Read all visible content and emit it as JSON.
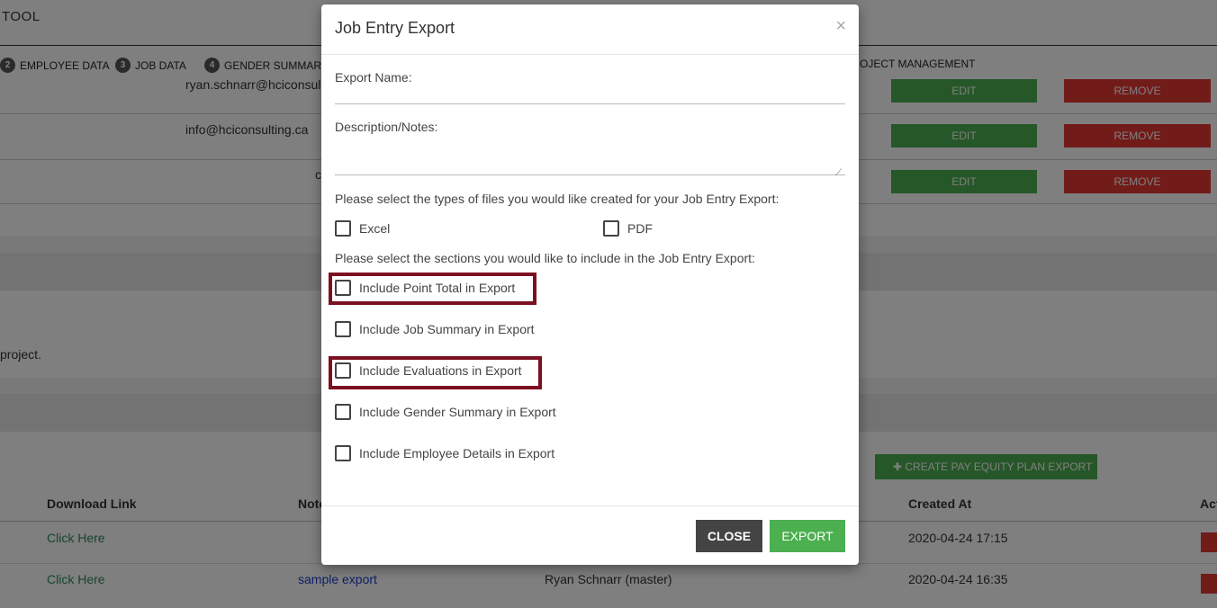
{
  "app": {
    "title": "TOOL"
  },
  "nav": {
    "items": [
      {
        "num": "2",
        "label": "EMPLOYEE DATA"
      },
      {
        "num": "3",
        "label": "JOB DATA"
      },
      {
        "num": "4",
        "label": "GENDER SUMMARY"
      }
    ],
    "project_management": "OJECT MANAGEMENT"
  },
  "users": {
    "rows": [
      {
        "email": "ryan.schnarr@hciconsul",
        "edit": "EDIT",
        "remove": "REMOVE"
      },
      {
        "email": "info@hciconsulting.ca",
        "edit": "EDIT",
        "remove": "REMOVE"
      },
      {
        "email": "c",
        "edit": "EDIT",
        "remove": "REMOVE"
      }
    ]
  },
  "project_note": "project.",
  "exports": {
    "create_button": "CREATE PAY EQUITY PLAN EXPORT",
    "headers": {
      "download": "Download Link",
      "notes": "Note",
      "created_at": "Created At",
      "actions": "Act"
    },
    "rows": [
      {
        "download": "Click Here",
        "notes": "",
        "created_by": "",
        "created_at": "2020-04-24 17:15"
      },
      {
        "download": "Click Here",
        "notes": "sample export",
        "created_by": "Ryan Schnarr (master)",
        "created_at": "2020-04-24 16:35"
      }
    ]
  },
  "modal": {
    "title": "Job Entry Export",
    "close_symbol": "×",
    "export_name_label": "Export Name:",
    "export_name_value": "",
    "description_label": "Description/Notes:",
    "description_value": "",
    "file_types_prompt": "Please select the types of files you would like created for your Job Entry Export:",
    "file_types": [
      {
        "label": "Excel",
        "checked": false
      },
      {
        "label": "PDF",
        "checked": false
      }
    ],
    "sections_prompt": "Please select the sections you would like to include in the Job Entry Export:",
    "sections": [
      {
        "label": "Include Point Total in Export",
        "checked": false,
        "highlighted": true
      },
      {
        "label": "Include Job Summary in Export",
        "checked": false,
        "highlighted": false
      },
      {
        "label": "Include Evaluations in Export",
        "checked": false,
        "highlighted": true
      },
      {
        "label": "Include Gender Summary in Export",
        "checked": false,
        "highlighted": false
      },
      {
        "label": "Include Employee Details in Export",
        "checked": false,
        "highlighted": false
      }
    ],
    "close_button": "CLOSE",
    "export_button": "EXPORT"
  },
  "colors": {
    "edit_green": "#4caf50",
    "remove_red": "#e53935",
    "close_dark": "#444444",
    "highlight_maroon": "#7b1020"
  }
}
